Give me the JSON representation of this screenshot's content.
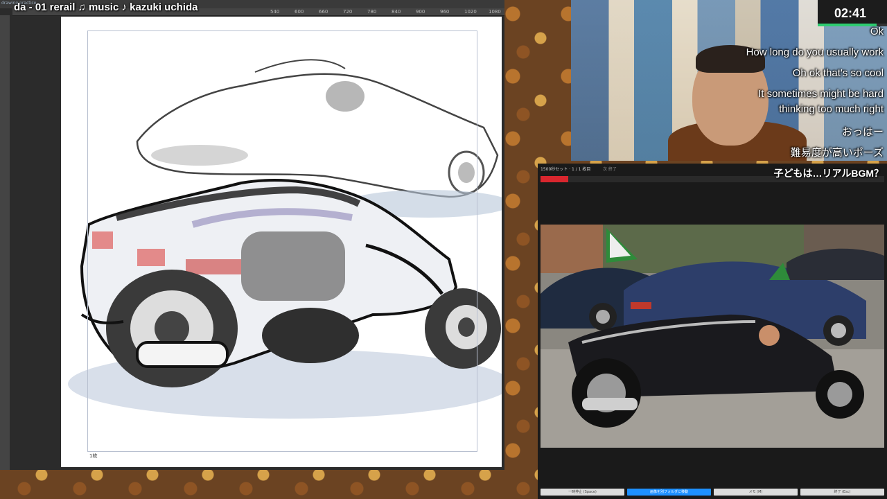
{
  "stream": {
    "title_overlay": "da - 01 rerail        ♫ music ♪ kazuki uchida",
    "tiny_label": "drawing practice"
  },
  "app": {
    "ruler_marks": [
      "540",
      "600",
      "660",
      "720",
      "780",
      "840",
      "900",
      "960",
      "1020",
      "1080"
    ],
    "page_label": "1枚"
  },
  "timer": {
    "value": "02:41",
    "progress": 0.85
  },
  "captions": [
    "Ok",
    "How long do you usually work",
    "Oh ok that's so cool",
    "It sometimes might be hard",
    "thinking too much right",
    "おっはー",
    "難易度が高いポーズ"
  ],
  "viewer": {
    "status": "1500秒セット · 1 / 1 枚目",
    "next_label": "次 終了",
    "progress": 0.08,
    "subtitle": "子どもは…リアルBGM？",
    "buttons": [
      "一時停止 (Space)",
      "画像を別フォルダに移動",
      "メモ (M)",
      "終了 (Esc)"
    ]
  },
  "colors": {
    "accent": "#1e90ff",
    "progress_red": "#d9262e",
    "timer_green": "#2ecc71"
  }
}
